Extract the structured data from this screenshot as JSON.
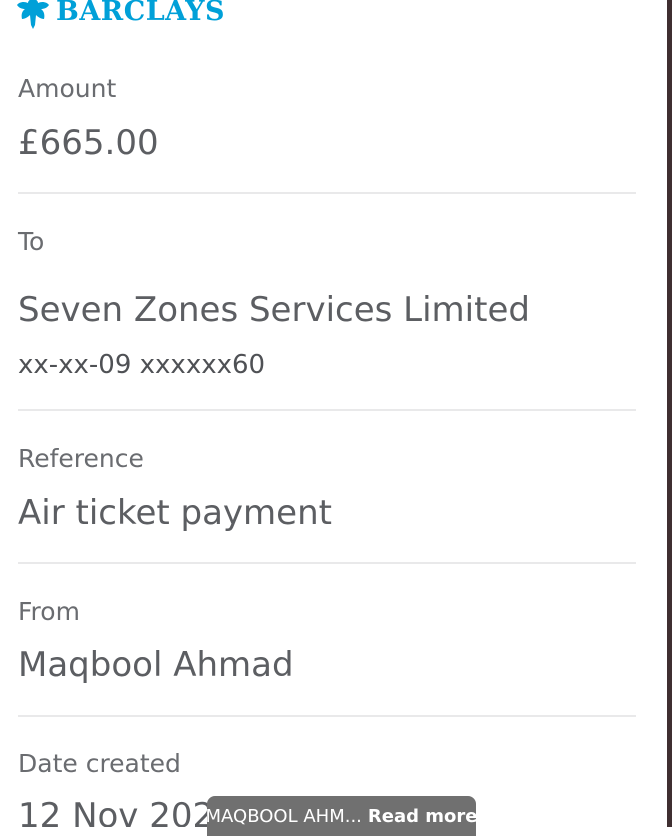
{
  "brand": {
    "name": "BARCLAYS",
    "color": "#00a0d8",
    "icon": "eagle-logo-icon"
  },
  "amount": {
    "label": "Amount",
    "value": "£665.00"
  },
  "to": {
    "label": "To",
    "name": "Seven Zones Services Limited",
    "account": "xx-xx-09 xxxxxx60"
  },
  "reference": {
    "label": "Reference",
    "value": "Air ticket payment"
  },
  "from": {
    "label": "From",
    "value": "Maqbool Ahmad"
  },
  "date_created": {
    "label": "Date created",
    "value": "12 Nov 2024 · 12:11"
  },
  "toast": {
    "text": "MAQBOOL AHM...",
    "action": "Read more"
  }
}
